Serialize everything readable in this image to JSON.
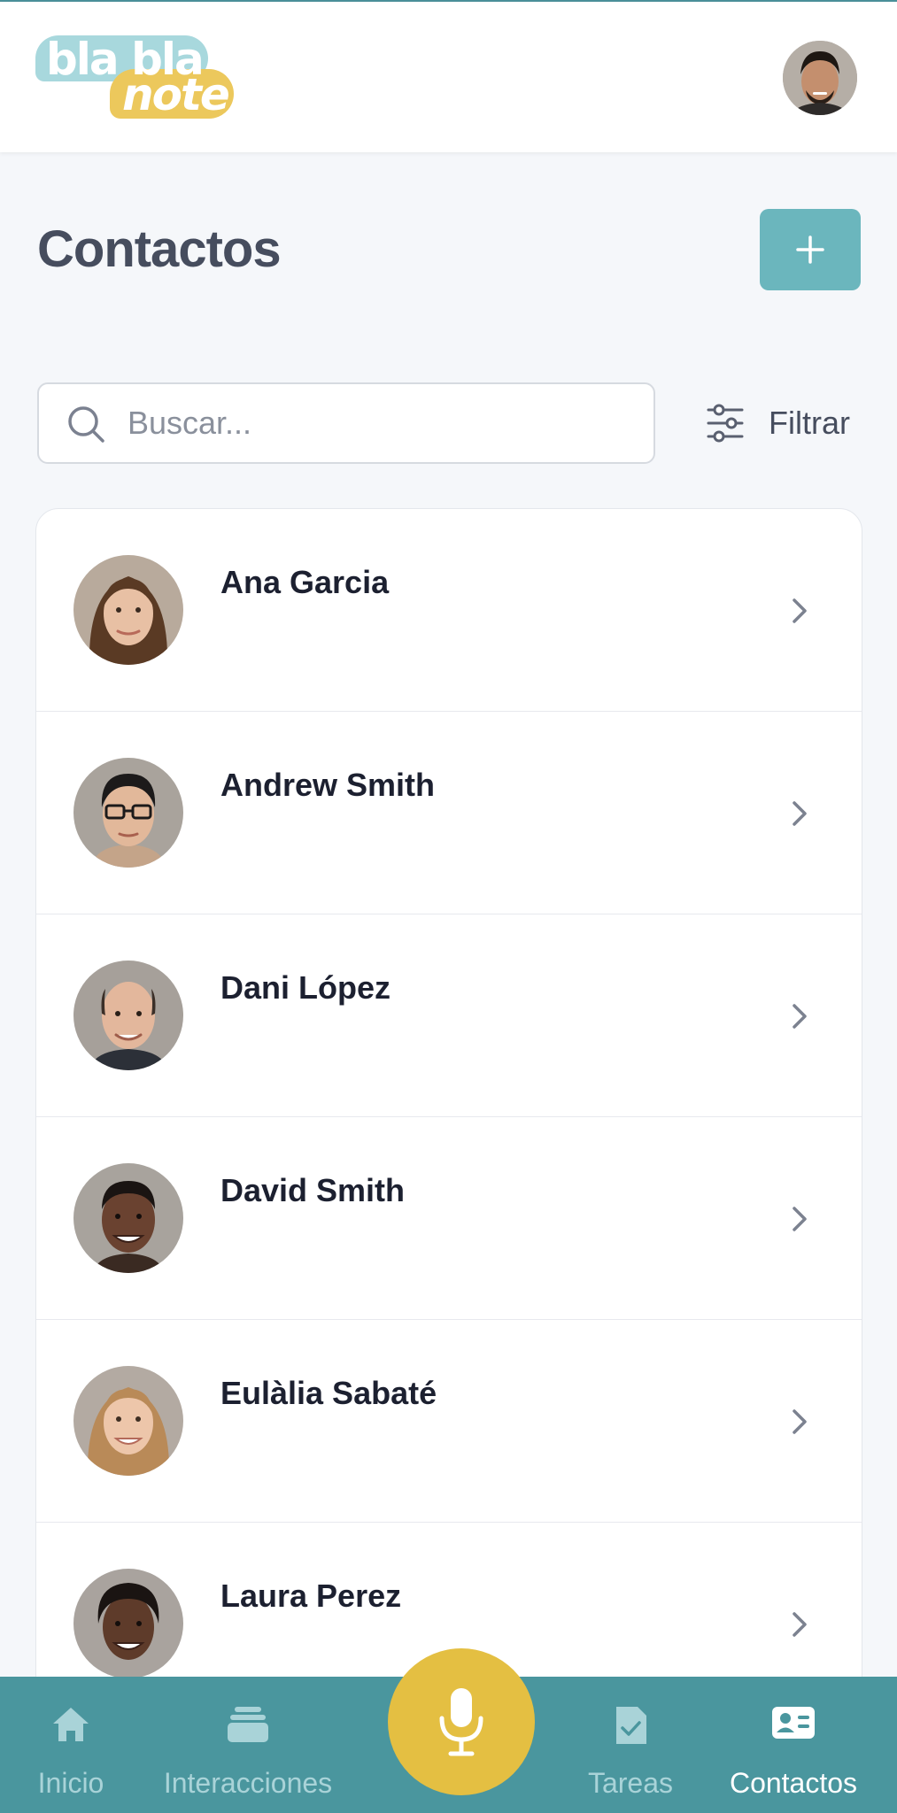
{
  "header": {
    "logo_line1": "bla bla",
    "logo_line2": "note",
    "colors": {
      "logo_teal": "#a8d8dd",
      "logo_yellow": "#ecc85c"
    }
  },
  "page": {
    "title": "Contactos",
    "add_button_icon": "plus-icon"
  },
  "search": {
    "placeholder": "Buscar...",
    "value": ""
  },
  "filter": {
    "label": "Filtrar",
    "icon": "sliders-icon"
  },
  "contacts": [
    {
      "name": "Ana Garcia",
      "skin": "#e8c0a4",
      "hair": "#5a3a24"
    },
    {
      "name": "Andrew Smith",
      "skin": "#e2b89a",
      "hair": "#1c1a1a"
    },
    {
      "name": "Dani López",
      "skin": "#e3b79c",
      "hair": "#3b2f28"
    },
    {
      "name": "David Smith",
      "skin": "#6a4230",
      "hair": "#1a1412"
    },
    {
      "name": "Eulàlia Sabaté",
      "skin": "#edc6aa",
      "hair": "#b98a58"
    },
    {
      "name": "Laura Perez",
      "skin": "#5e3b2a",
      "hair": "#1a1412"
    }
  ],
  "bottom_nav": {
    "items": [
      {
        "label": "Inicio",
        "icon": "home-icon",
        "active": false
      },
      {
        "label": "Interacciones",
        "icon": "stack-icon",
        "active": false
      },
      {
        "label": "Tareas",
        "icon": "task-check-icon",
        "active": false
      },
      {
        "label": "Contactos",
        "icon": "contact-card-icon",
        "active": true
      }
    ],
    "center_icon": "microphone-icon",
    "colors": {
      "bar": "#4a969e",
      "mic": "#e4bf42",
      "inactive": "#a9d3d8",
      "active": "#ffffff"
    }
  },
  "colors": {
    "accent": "#6bb6bd",
    "title": "#464d5e",
    "background": "#f5f7fa"
  }
}
